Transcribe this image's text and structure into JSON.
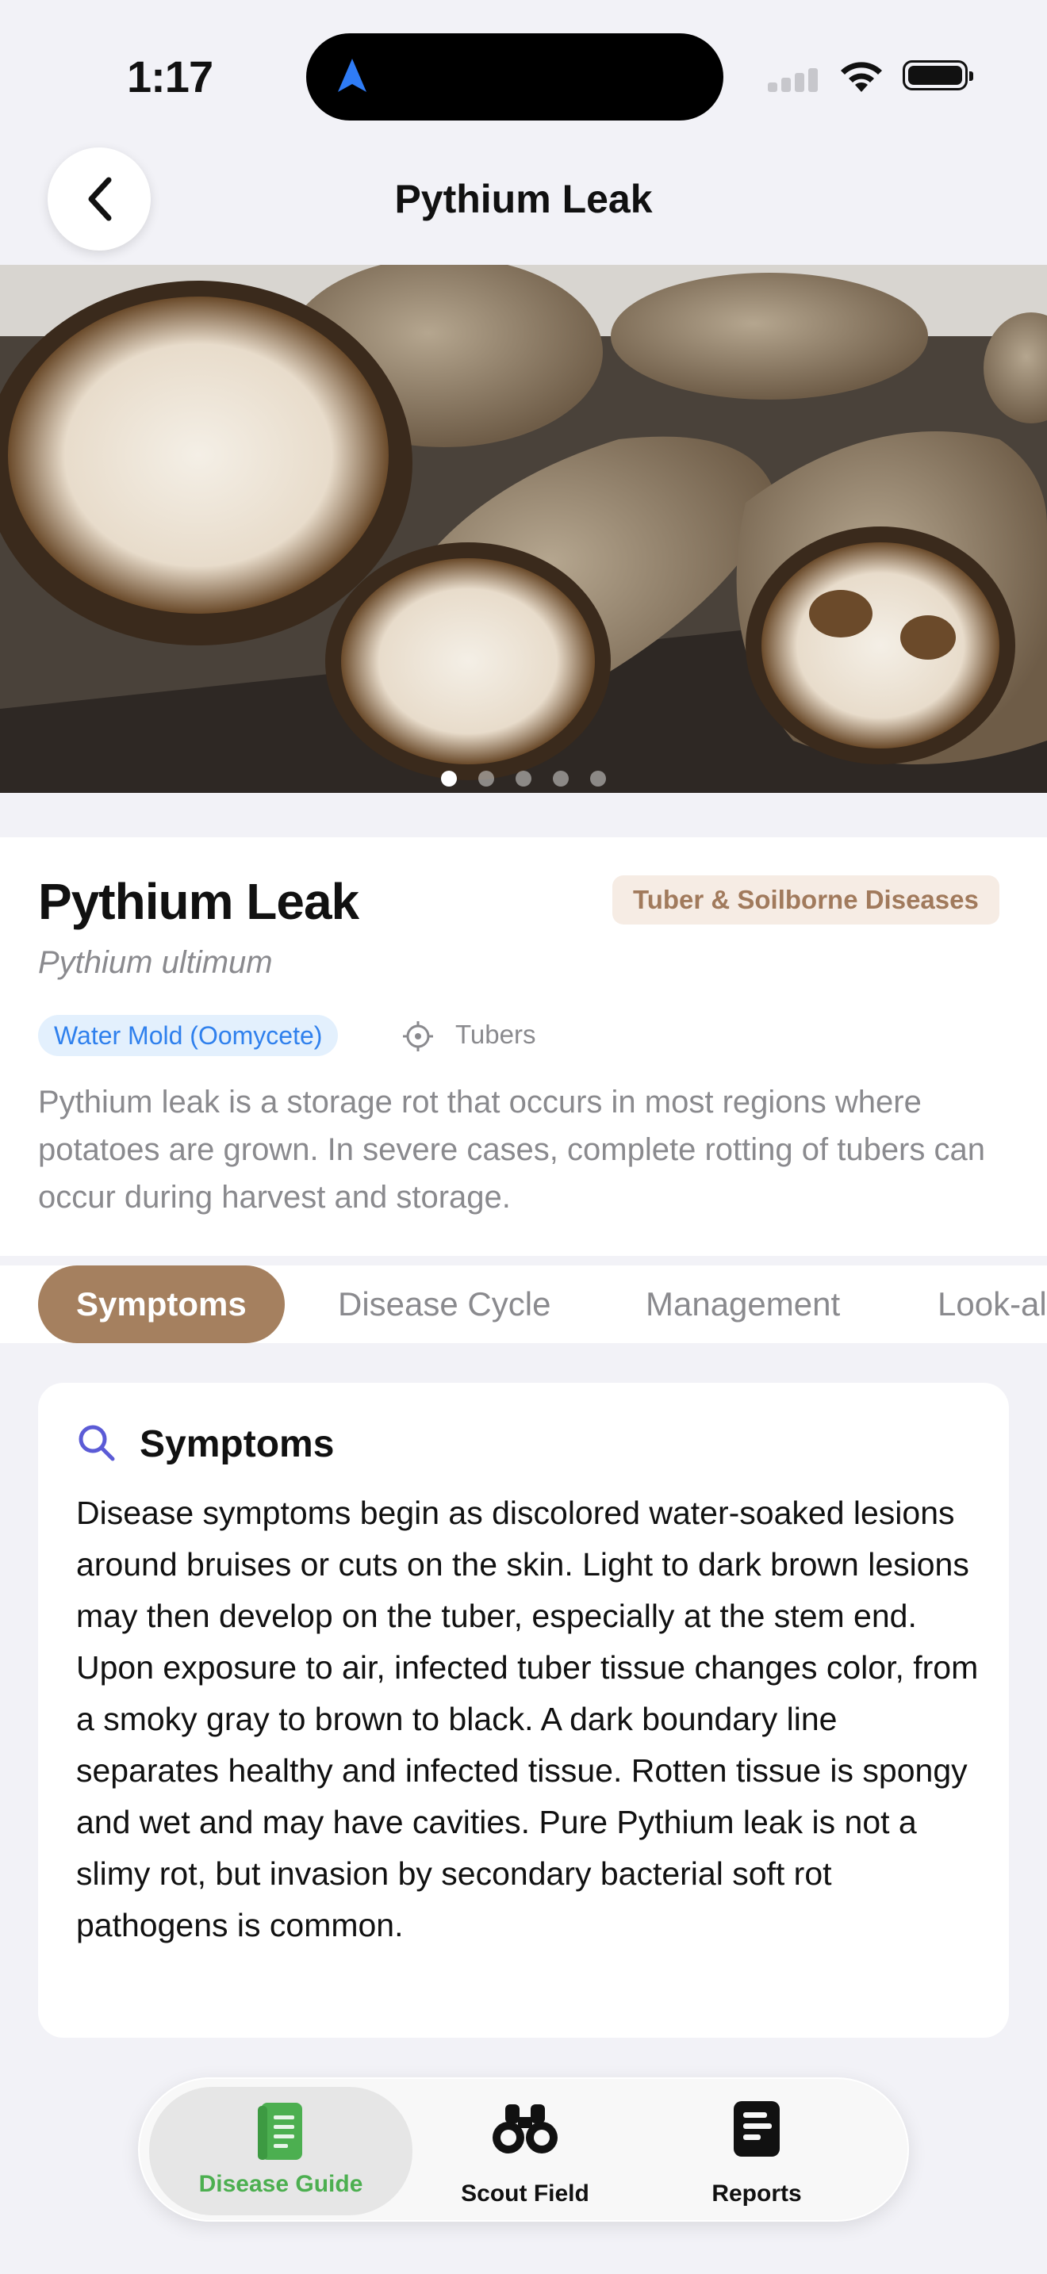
{
  "status": {
    "time": "1:17"
  },
  "nav": {
    "title": "Pythium Leak"
  },
  "gallery": {
    "page_count": 5,
    "active_index": 0
  },
  "disease": {
    "name": "Pythium Leak",
    "scientific_name": "Pythium ultimum",
    "category": "Tuber & Soilborne Diseases",
    "pathogen_type": "Water Mold (Oomycete)",
    "affected_part": "Tubers",
    "description": "Pythium leak is a storage rot that occurs in most regions where potatoes are grown. In severe cases, complete rotting of tubers can occur during harvest and storage."
  },
  "tabs": [
    {
      "label": "Symptoms",
      "active": true
    },
    {
      "label": "Disease Cycle",
      "active": false
    },
    {
      "label": "Management",
      "active": false
    },
    {
      "label": "Look-al",
      "active": false
    }
  ],
  "symptoms_card": {
    "title": "Symptoms",
    "icon": "search-icon",
    "body": "Disease symptoms begin as discolored water-soaked lesions around bruises or cuts on the skin. Light to dark brown lesions may then develop on the tuber, especially at the stem end. Upon exposure to air, infected tuber tissue changes color, from a smoky gray to brown to black. A dark boundary line separates healthy and infected tissue. Rotten tissue is spongy and wet and may have cavities. Pure Pythium leak is not a slimy rot, but invasion by secondary bacterial soft rot pathogens is common."
  },
  "tabbar": {
    "items": [
      {
        "label": "Disease Guide",
        "icon": "book-icon",
        "active": true
      },
      {
        "label": "Scout Field",
        "icon": "binoculars-icon",
        "active": false
      },
      {
        "label": "Reports",
        "icon": "report-icon",
        "active": false
      }
    ]
  },
  "colors": {
    "accent_brown": "#a5805f",
    "category_text": "#a17a5c",
    "type_badge_text": "#2f80ed",
    "active_tab_green": "#4caf50",
    "search_icon": "#5b5bd6"
  }
}
